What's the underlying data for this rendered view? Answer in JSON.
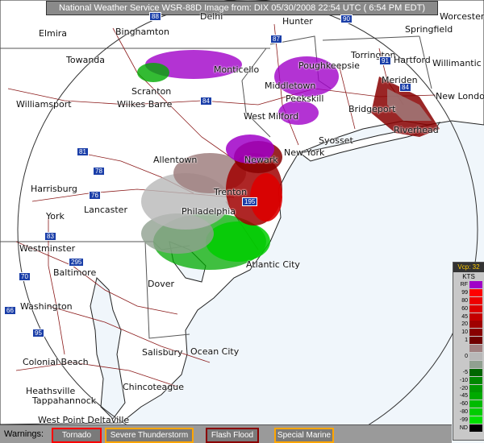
{
  "title": "National Weather Service WSR-88D Image from: DIX 05/30/2008 22:54 UTC ( 6:54 PM EDT)",
  "map_labels": {
    "elmira": "Elmira",
    "binghamton": "Binghamton",
    "delhi": "Delhi",
    "hunter": "Hunter",
    "worcester": "Worcester",
    "springfield": "Springfield",
    "towanda": "Towanda",
    "monticello": "Monticello",
    "poughkeepsie": "Poughkeepsie",
    "torrington": "Torrington",
    "hartford": "Hartford",
    "willimantic": "Willimantic",
    "scranton": "Scranton",
    "middletown": "Middletown",
    "meriden": "Meriden",
    "new_london": "New London",
    "williamsport": "Williamsport",
    "wilkes_barre": "Wilkes Barre",
    "peekskill": "Peekskill",
    "bridgeport": "Bridgeport",
    "west_milford": "West Milford",
    "riverhead": "Riverhead",
    "syosset": "Syosset",
    "new_york": "New York",
    "allentown": "Allentown",
    "newark": "Newark",
    "harrisburg": "Harrisburg",
    "trenton": "Trenton",
    "york": "York",
    "lancaster": "Lancaster",
    "philadelphia": "Philadelphia",
    "westminster": "Westminster",
    "atlantic_city": "Atlantic City",
    "baltimore": "Baltimore",
    "dover": "Dover",
    "washington": "Washington",
    "salisbury": "Salisbury",
    "ocean_city": "Ocean City",
    "colonial_beach": "Colonial Beach",
    "heathsville": "Heathsville",
    "tappahannock": "Tappahannock",
    "chincoteague": "Chincoteague",
    "west_point_deltaville": "West Point Deltaville"
  },
  "highways": {
    "h1": "88",
    "h2": "87",
    "h3": "90",
    "h4": "84",
    "h5": "84",
    "h6": "81",
    "h7": "78",
    "h8": "76",
    "h9": "195",
    "h10": "91",
    "h11": "83",
    "h12": "70",
    "h13": "66",
    "h14": "95",
    "h15": "295"
  },
  "legend": {
    "header": "Vcp: 32",
    "units": "KTS",
    "entries": [
      {
        "label": "RF",
        "color": "#a000c8"
      },
      {
        "label": "99",
        "color": "#ff0000"
      },
      {
        "label": "80",
        "color": "#ee0000"
      },
      {
        "label": "60",
        "color": "#dd0000"
      },
      {
        "label": "45",
        "color": "#c40000"
      },
      {
        "label": "20",
        "color": "#a00000"
      },
      {
        "label": "10",
        "color": "#880000"
      },
      {
        "label": "1",
        "color": "#700000"
      },
      {
        "label": "",
        "color": "#a08080"
      },
      {
        "label": "0",
        "color": "#b8b8b8"
      },
      {
        "label": "",
        "color": "#90a090"
      },
      {
        "label": "-5",
        "color": "#006600"
      },
      {
        "label": "-10",
        "color": "#008800"
      },
      {
        "label": "-20",
        "color": "#009900"
      },
      {
        "label": "-45",
        "color": "#00aa00"
      },
      {
        "label": "-60",
        "color": "#00bb00"
      },
      {
        "label": "-80",
        "color": "#00cc00"
      },
      {
        "label": "-99",
        "color": "#00e000"
      },
      {
        "label": "ND",
        "color": "#000000"
      }
    ]
  },
  "warnings": {
    "label": "Warnings:",
    "items": [
      {
        "label": "Tornado",
        "border": "#ff0000"
      },
      {
        "label": "Severe Thunderstorm",
        "border": "#ffa500"
      },
      {
        "label": "Flash Flood",
        "border": "#8b0000"
      },
      {
        "label": "Special Marine",
        "border": "#ffa500"
      }
    ]
  },
  "colors": {
    "ocean": "#f0f6fb",
    "land": "#ffffff",
    "title_bg": "#8a8a8a",
    "warn_bg": "#9a9a9a"
  }
}
